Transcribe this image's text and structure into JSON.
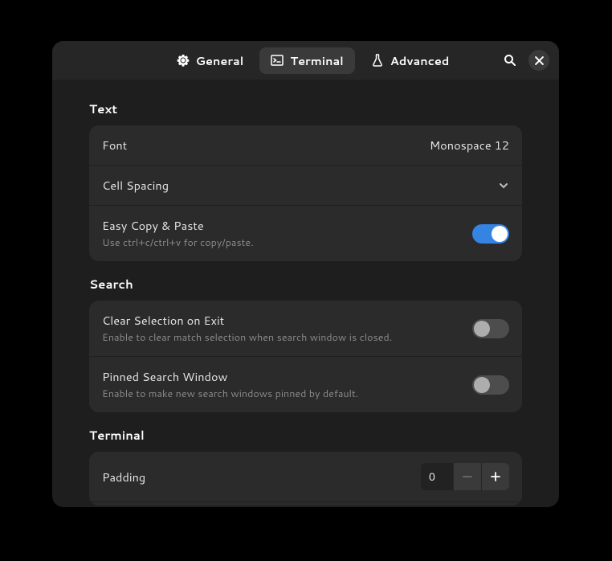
{
  "header": {
    "tabs": {
      "general": "General",
      "terminal": "Terminal",
      "advanced": "Advanced"
    }
  },
  "sections": {
    "text": {
      "title": "Text",
      "font": {
        "label": "Font",
        "value": "Monospace 12"
      },
      "cellSpacing": {
        "label": "Cell Spacing"
      },
      "easyCopy": {
        "label": "Easy Copy & Paste",
        "subtitle": "Use ctrl+c/ctrl+v for copy/paste."
      }
    },
    "search": {
      "title": "Search",
      "clearSelection": {
        "label": "Clear Selection on Exit",
        "subtitle": "Enable to clear match selection when search window is closed."
      },
      "pinned": {
        "label": "Pinned Search Window",
        "subtitle": "Enable to make new search windows pinned by default."
      }
    },
    "terminal": {
      "title": "Terminal",
      "padding": {
        "label": "Padding",
        "value": "0"
      }
    }
  }
}
